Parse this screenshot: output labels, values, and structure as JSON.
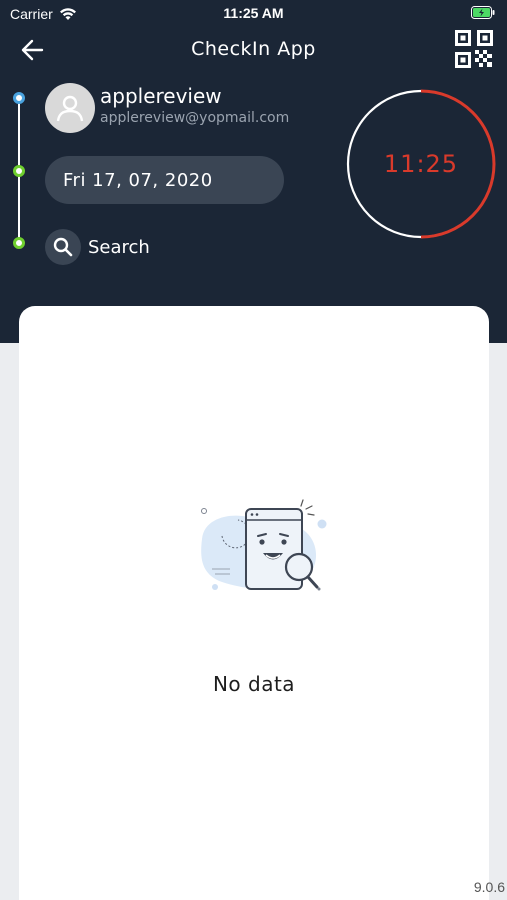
{
  "status_bar": {
    "carrier": "Carrier",
    "time": "11:25 AM"
  },
  "nav": {
    "title": "CheckIn App"
  },
  "user": {
    "name": "applereview",
    "email": "applereview@yopmail.com"
  },
  "date_label": "Fri 17, 07, 2020",
  "search_label": "Search",
  "timer": {
    "time": "11:25",
    "progress": 0.5
  },
  "empty_state": {
    "message": "No data"
  },
  "version": "9.0.6",
  "colors": {
    "header": "#1b2636",
    "accent_red": "#d93a2b",
    "timeline_blue": "#4aa3df",
    "timeline_green": "#6fcf2f"
  },
  "icons": [
    "back-arrow-icon",
    "qr-code-icon",
    "user-icon",
    "search-icon",
    "wifi-icon",
    "battery-icon"
  ]
}
